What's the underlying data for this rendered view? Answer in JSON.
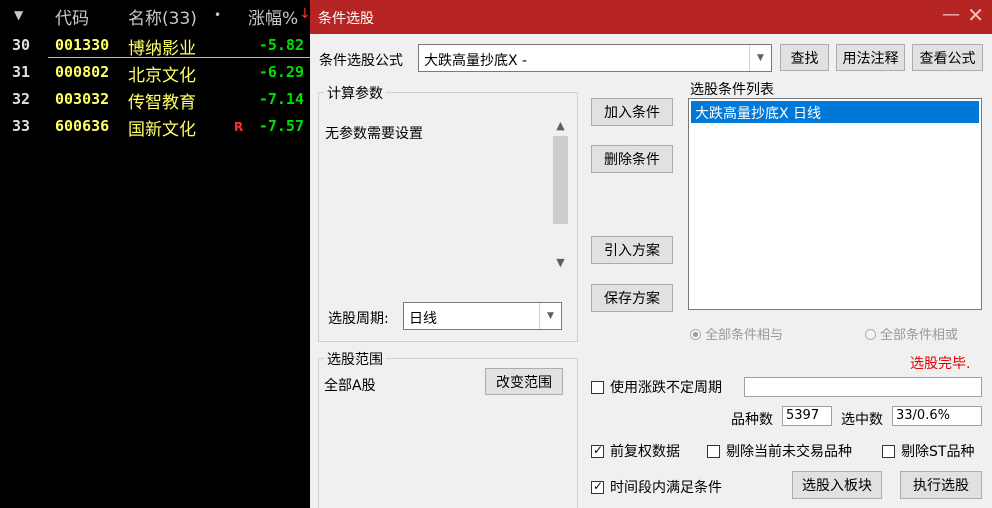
{
  "stock_list": {
    "headers": {
      "sort_icon": "▼",
      "code": "代码",
      "name": "名称(33)",
      "dot": "•",
      "change": "涨幅%",
      "sort_arrow": "↓"
    },
    "rows": [
      {
        "idx": "30",
        "code": "001330",
        "name": "博纳影业",
        "flag": "",
        "change": "-5.82"
      },
      {
        "idx": "31",
        "code": "000802",
        "name": "北京文化",
        "flag": "",
        "change": "-6.29"
      },
      {
        "idx": "32",
        "code": "003032",
        "name": "传智教育",
        "flag": "",
        "change": "-7.14"
      },
      {
        "idx": "33",
        "code": "600636",
        "name": "国新文化",
        "flag": "R",
        "change": "-7.57"
      }
    ]
  },
  "dialog": {
    "title": "条件选股",
    "minimize": "—",
    "close": "✕",
    "formula_label": "条件选股公式",
    "formula_value": "大跌高量抄底X  -",
    "btn_find": "查找",
    "btn_usage": "用法注释",
    "btn_view_formula": "查看公式",
    "params_group": "计算参数",
    "params_text": "无参数需要设置",
    "period_label": "选股周期:",
    "period_value": "日线",
    "btn_add": "加入条件",
    "btn_delete": "删除条件",
    "btn_import": "引入方案",
    "btn_save": "保存方案",
    "conditions_label": "选股条件列表",
    "conditions": [
      "大跌高量抄底X  日线"
    ],
    "radio_and": "全部条件相与",
    "radio_or": "全部条件相或",
    "status": "选股完毕.",
    "range_group": "选股范围",
    "range_value": "全部A股",
    "btn_change_range": "改变范围",
    "chk_variable_period": "使用涨跌不定周期",
    "variable_period_value": "",
    "count_label": "品种数",
    "count_value": "5397",
    "selected_label": "选中数",
    "selected_value": "33/0.6%",
    "chk_forward_adjust": "前复权数据",
    "chk_exclude_untraded": "剔除当前未交易品种",
    "chk_exclude_st": "剔除ST品种",
    "chk_timespan": "时间段内满足条件",
    "btn_to_block": "选股入板块",
    "btn_execute": "执行选股"
  }
}
